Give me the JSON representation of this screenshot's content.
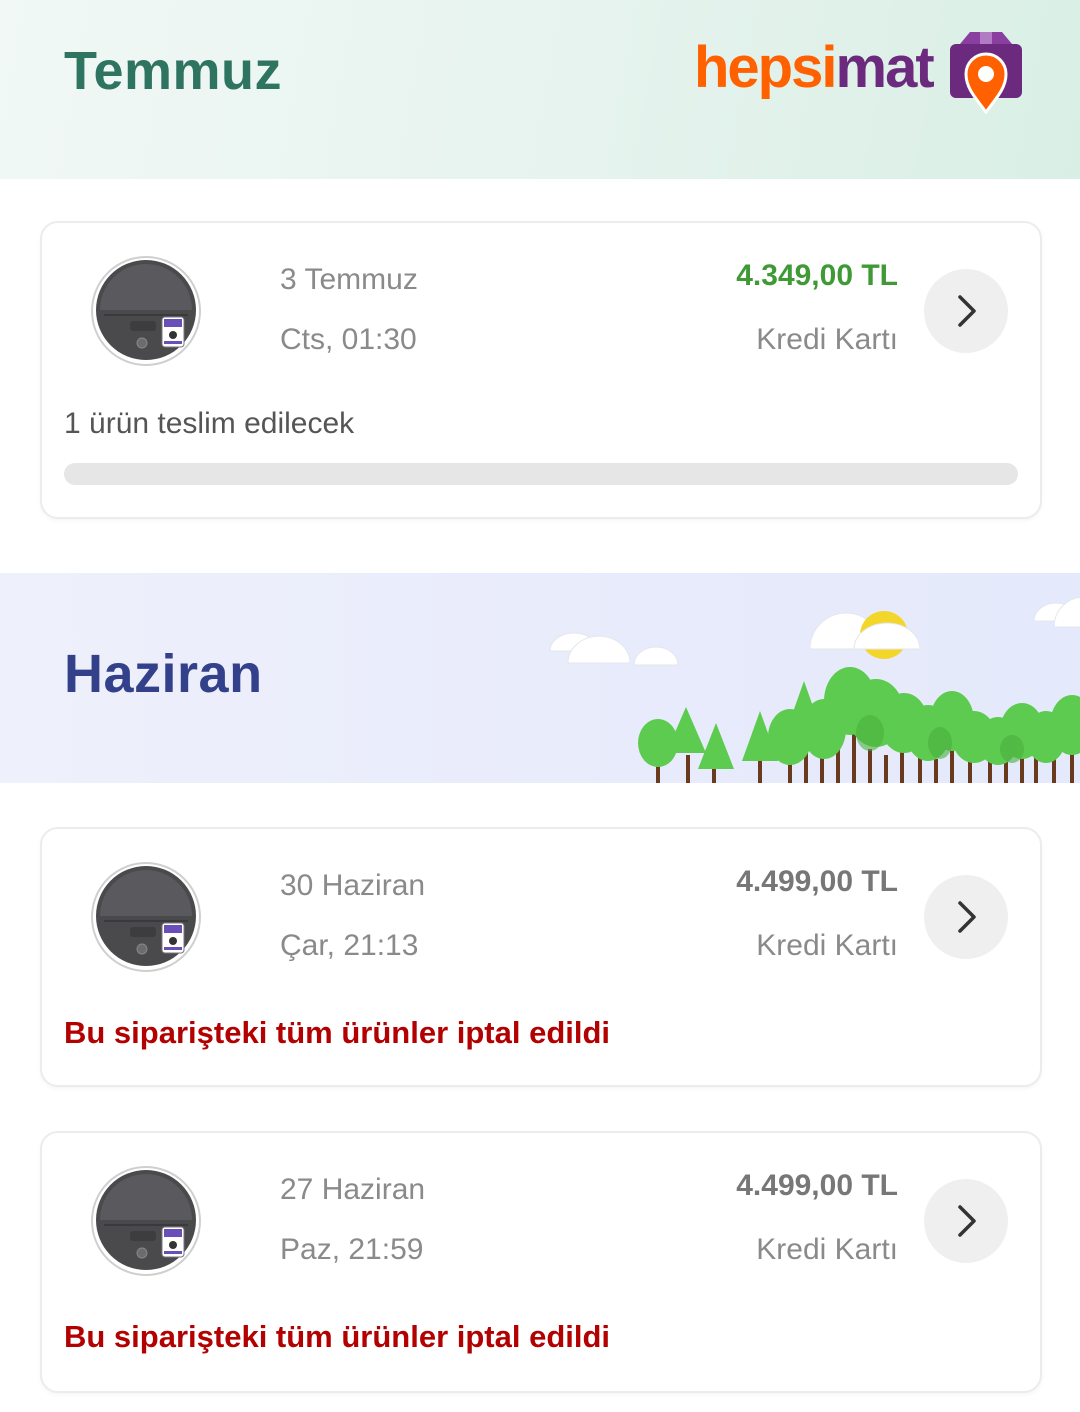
{
  "colors": {
    "price_highlight": "#3f9a36",
    "cancel_red": "#b30000",
    "july_title": "#2f7461",
    "june_title": "#33418a",
    "brand_orange": "#ff6000",
    "brand_purple": "#6b2a7e"
  },
  "logo": {
    "part1": "hepsi",
    "part2": "mat",
    "icon": "pin-box-icon"
  },
  "sections": [
    {
      "month": "Temmuz",
      "orders": [
        {
          "date": "3 Temmuz",
          "time": "Cts, 01:30",
          "price": "4.349,00 TL",
          "payment": "Kredi Kartı",
          "status": "1 ürün teslim edilecek",
          "progress": 0,
          "thumb_icon": "robot-vacuum-icon",
          "action_icon": "chevron-right-icon"
        }
      ]
    },
    {
      "month": "Haziran",
      "orders": [
        {
          "date": "30 Haziran",
          "time": "Çar, 21:13",
          "price": "4.499,00 TL",
          "payment": "Kredi Kartı",
          "status": "Bu siparişteki tüm ürünler iptal edildi",
          "thumb_icon": "robot-vacuum-icon",
          "action_icon": "chevron-right-icon"
        },
        {
          "date": "27 Haziran",
          "time": "Paz, 21:59",
          "price": "4.499,00 TL",
          "payment": "Kredi Kartı",
          "status": "Bu siparişteki tüm ürünler iptal edildi",
          "thumb_icon": "robot-vacuum-icon",
          "action_icon": "chevron-right-icon"
        }
      ]
    }
  ]
}
